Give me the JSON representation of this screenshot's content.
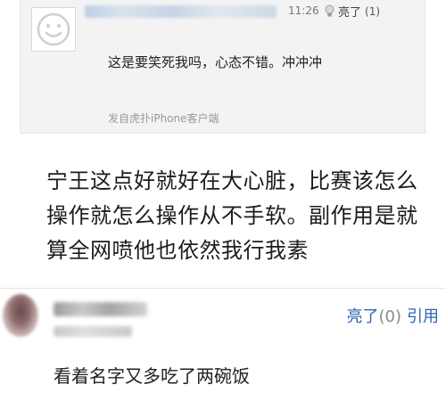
{
  "quote": {
    "time": "11:26",
    "like_label": "亮了",
    "like_count": "(1)",
    "text": "这是要笑死我吗，心态不错。冲冲冲",
    "source": "发自虎扑iPhone客户端",
    "avatar_icon": "default-avatar-icon",
    "bulb_icon": "lightbulb-icon"
  },
  "caption": {
    "text": "宁王这点好就好在大心脏，比赛该怎么操作就怎么操作从不手软。副作用是就算全网喷他也依然我行我素"
  },
  "comment": {
    "like_label": "亮了",
    "like_count": "(0)",
    "reply_label": "引用",
    "text": "看着名字又多吃了两碗饭",
    "accent_color": "#2d64b3"
  }
}
